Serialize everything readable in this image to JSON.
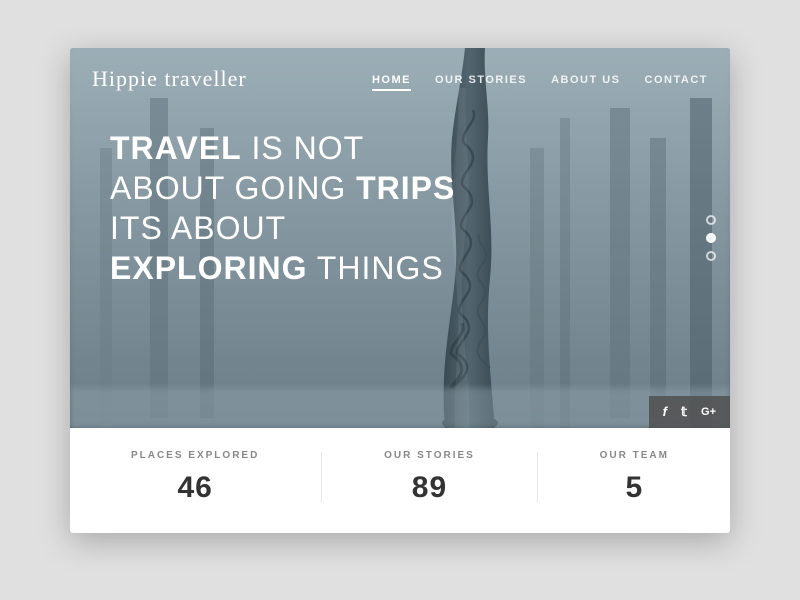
{
  "brand": {
    "logo": "Hippie traveller"
  },
  "nav": {
    "items": [
      {
        "label": "HOME",
        "active": true
      },
      {
        "label": "OUR STORIES",
        "active": false
      },
      {
        "label": "ABOUT US",
        "active": false
      },
      {
        "label": "CONTACT",
        "active": false
      }
    ]
  },
  "hero": {
    "line1_normal": "TRAVEL",
    "line1_rest": " IS NOT",
    "line2_start": "ABOUT GOING ",
    "line2_bold": "TRIPS",
    "line3": "ITS ABOUT",
    "line4_bold": "EXPLORING",
    "line4_rest": " THINGS"
  },
  "dots": [
    {
      "active": false
    },
    {
      "active": true
    },
    {
      "active": false
    }
  ],
  "social": {
    "facebook": "f",
    "twitter": "t",
    "googleplus": "G+"
  },
  "stats": [
    {
      "label": "PLACES EXPLORED",
      "value": "46"
    },
    {
      "label": "OUR STORIES",
      "value": "89"
    },
    {
      "label": "OUR TEAM",
      "value": "5"
    }
  ],
  "colors": {
    "accent": "#ffffff",
    "hero_bg_start": "#8fa4b0",
    "hero_bg_end": "#4a5e6a",
    "text_dark": "#333333",
    "text_muted": "#888888"
  }
}
